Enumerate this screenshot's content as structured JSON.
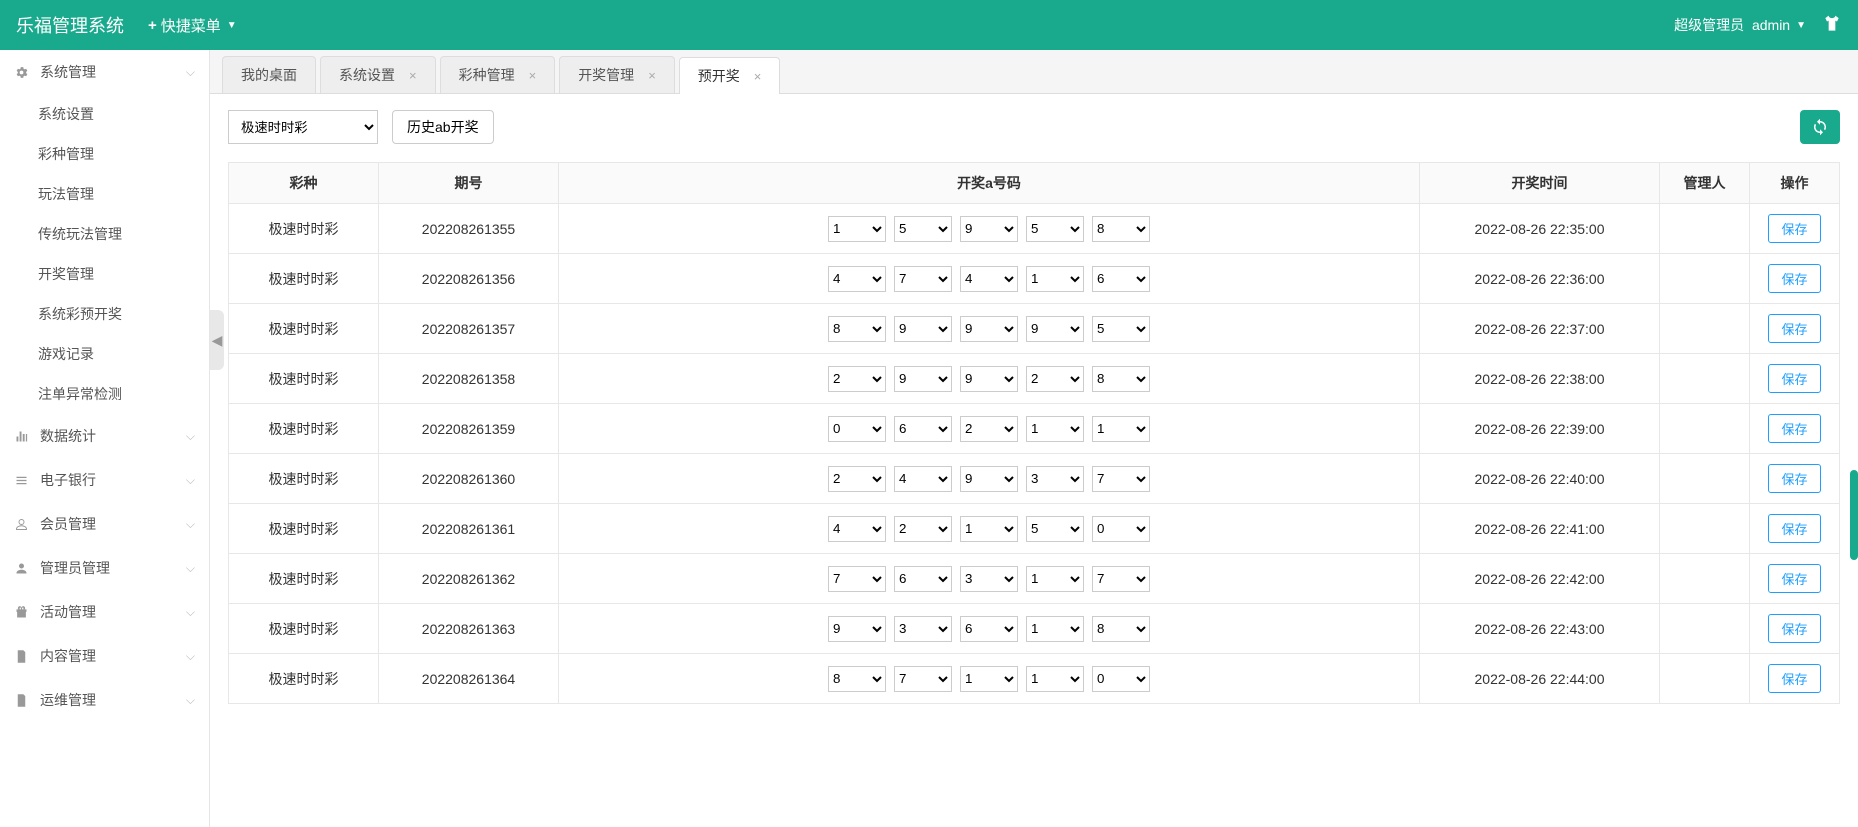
{
  "header": {
    "brand": "乐福管理系统",
    "quick_menu": "快捷菜单",
    "user_role": "超级管理员",
    "user_name": "admin"
  },
  "sidebar": {
    "groups": [
      {
        "label": "系统管理",
        "icon": "gear-icon",
        "expanded": true,
        "items": [
          "系统设置",
          "彩种管理",
          "玩法管理",
          "传统玩法管理",
          "开奖管理",
          "系统彩预开奖",
          "游戏记录",
          "注单异常检测"
        ]
      },
      {
        "label": "数据统计",
        "icon": "bars-icon",
        "expanded": false,
        "items": []
      },
      {
        "label": "电子银行",
        "icon": "list-icon",
        "expanded": false,
        "items": []
      },
      {
        "label": "会员管理",
        "icon": "user-icon",
        "expanded": false,
        "items": []
      },
      {
        "label": "管理员管理",
        "icon": "user-solid-icon",
        "expanded": false,
        "items": []
      },
      {
        "label": "活动管理",
        "icon": "gift-icon",
        "expanded": false,
        "items": []
      },
      {
        "label": "内容管理",
        "icon": "doc-icon",
        "expanded": false,
        "items": []
      },
      {
        "label": "运维管理",
        "icon": "doc-icon",
        "expanded": false,
        "items": []
      }
    ]
  },
  "tabs": [
    {
      "label": "我的桌面",
      "closable": false,
      "active": false
    },
    {
      "label": "系统设置",
      "closable": true,
      "active": false
    },
    {
      "label": "彩种管理",
      "closable": true,
      "active": false
    },
    {
      "label": "开奖管理",
      "closable": true,
      "active": false
    },
    {
      "label": "预开奖",
      "closable": true,
      "active": true
    }
  ],
  "toolbar": {
    "lottery_selected": "极速时时彩",
    "history_btn": "历史ab开奖"
  },
  "table": {
    "headers": [
      "彩种",
      "期号",
      "开奖a号码",
      "开奖时间",
      "管理人",
      "操作"
    ],
    "save_label": "保存",
    "rows": [
      {
        "lottery": "极速时时彩",
        "issue": "202208261355",
        "nums": [
          "1",
          "5",
          "9",
          "5",
          "8"
        ],
        "time": "2022-08-26 22:35:00",
        "admin": ""
      },
      {
        "lottery": "极速时时彩",
        "issue": "202208261356",
        "nums": [
          "4",
          "7",
          "4",
          "1",
          "6"
        ],
        "time": "2022-08-26 22:36:00",
        "admin": ""
      },
      {
        "lottery": "极速时时彩",
        "issue": "202208261357",
        "nums": [
          "8",
          "9",
          "9",
          "9",
          "5"
        ],
        "time": "2022-08-26 22:37:00",
        "admin": ""
      },
      {
        "lottery": "极速时时彩",
        "issue": "202208261358",
        "nums": [
          "2",
          "9",
          "9",
          "2",
          "8"
        ],
        "time": "2022-08-26 22:38:00",
        "admin": ""
      },
      {
        "lottery": "极速时时彩",
        "issue": "202208261359",
        "nums": [
          "0",
          "6",
          "2",
          "1",
          "1"
        ],
        "time": "2022-08-26 22:39:00",
        "admin": ""
      },
      {
        "lottery": "极速时时彩",
        "issue": "202208261360",
        "nums": [
          "2",
          "4",
          "9",
          "3",
          "7"
        ],
        "time": "2022-08-26 22:40:00",
        "admin": ""
      },
      {
        "lottery": "极速时时彩",
        "issue": "202208261361",
        "nums": [
          "4",
          "2",
          "1",
          "5",
          "0"
        ],
        "time": "2022-08-26 22:41:00",
        "admin": ""
      },
      {
        "lottery": "极速时时彩",
        "issue": "202208261362",
        "nums": [
          "7",
          "6",
          "3",
          "1",
          "7"
        ],
        "time": "2022-08-26 22:42:00",
        "admin": ""
      },
      {
        "lottery": "极速时时彩",
        "issue": "202208261363",
        "nums": [
          "9",
          "3",
          "6",
          "1",
          "8"
        ],
        "time": "2022-08-26 22:43:00",
        "admin": ""
      },
      {
        "lottery": "极速时时彩",
        "issue": "202208261364",
        "nums": [
          "8",
          "7",
          "1",
          "1",
          "0"
        ],
        "time": "2022-08-26 22:44:00",
        "admin": ""
      }
    ]
  }
}
